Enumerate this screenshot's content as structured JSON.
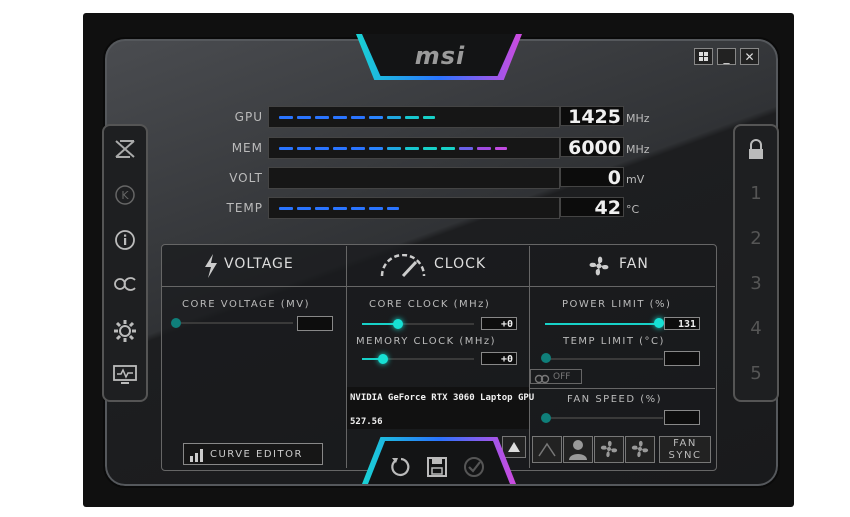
{
  "app": {
    "logo": "msi"
  },
  "window_controls": {
    "windows_icon": "windows-icon",
    "minimize": "_",
    "close": "✕"
  },
  "monitors": [
    {
      "label": "GPU",
      "value": "1425",
      "unit": "MHz"
    },
    {
      "label": "MEM",
      "value": "6000",
      "unit": "MHz"
    },
    {
      "label": "VOLT",
      "value": "0",
      "unit": "mV"
    },
    {
      "label": "TEMP",
      "value": "42",
      "unit": "°C"
    }
  ],
  "sections": {
    "voltage": "VOLTAGE",
    "clock": "CLOCK",
    "fan": "FAN"
  },
  "voltage": {
    "core_voltage_label": "CORE VOLTAGE  (MV)",
    "core_voltage_value": "",
    "core_voltage_level": 0.0
  },
  "clock": {
    "core_clock_label": "CORE CLOCK (MHz)",
    "core_clock_value": "+0",
    "core_clock_level": 0.35,
    "memory_clock_label": "MEMORY CLOCK (MHz)",
    "memory_clock_value": "+0",
    "memory_clock_level": 0.3
  },
  "fan": {
    "power_limit_label": "POWER LIMIT (%)",
    "power_limit_value": "131",
    "power_limit_level": 1.0,
    "temp_limit_label": "TEMP LIMIT (°C)",
    "temp_limit_value": "",
    "toggle_label": "OFF",
    "fan_speed_label": "FAN SPEED (%)",
    "fan_speed_value": ""
  },
  "gpu": {
    "name": "NVIDIA GeForce RTX 3060 Laptop GPU",
    "driver": "527.56"
  },
  "buttons": {
    "curve_editor": "CURVE EDITOR",
    "fan_sync_1": "FAN",
    "fan_sync_2": "SYNC"
  },
  "profiles": [
    "1",
    "2",
    "3",
    "4",
    "5"
  ],
  "colors": {
    "accent_cyan": "#17d1c8",
    "accent_blue": "#2a74ff",
    "accent_purple": "#c04ae0"
  }
}
